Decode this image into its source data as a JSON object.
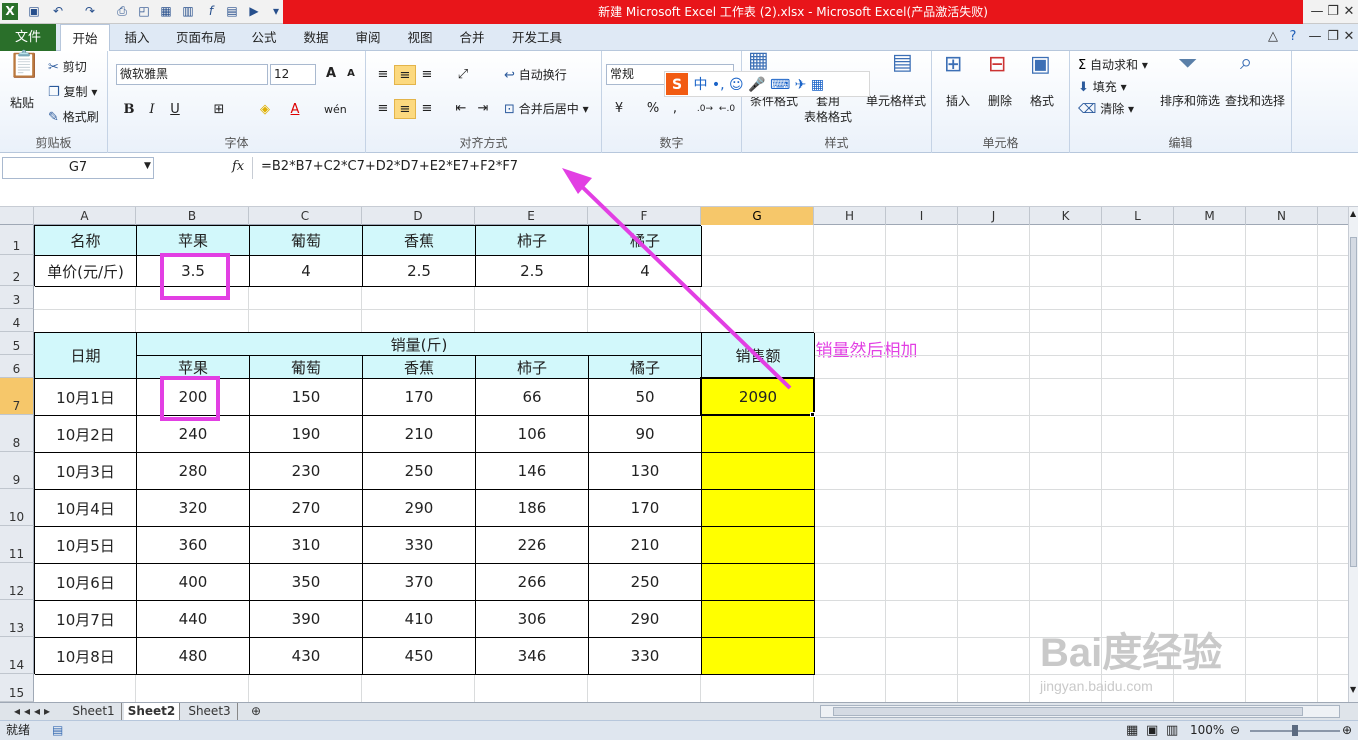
{
  "window": {
    "title": "新建 Microsoft Excel 工作表 (2).xlsx - Microsoft Excel(产品激活失败)"
  },
  "tabs": [
    "文件",
    "开始",
    "插入",
    "页面布局",
    "公式",
    "数据",
    "审阅",
    "视图",
    "合并",
    "开发工具"
  ],
  "ribbon": {
    "clipboard": {
      "paste": "粘贴",
      "cut": "剪切",
      "copy": "复制",
      "painter": "格式刷",
      "label": "剪贴板"
    },
    "font": {
      "name": "微软雅黑",
      "size": "12",
      "label": "字体"
    },
    "align": {
      "wrap": "自动换行",
      "merge": "合并后居中",
      "label": "对齐方式"
    },
    "number": {
      "format": "常规",
      "label": "数字"
    },
    "styles": {
      "cond": "条件格式",
      "table": "套用\n表格格式",
      "cell": "单元格样式",
      "label": "样式"
    },
    "cells": {
      "insert": "插入",
      "delete": "删除",
      "format": "格式",
      "label": "单元格"
    },
    "edit": {
      "autosum": "自动求和",
      "fill": "填充",
      "clear": "清除",
      "sort": "排序和筛选",
      "find": "查找和选择",
      "label": "编辑"
    }
  },
  "formula_bar": {
    "namebox": "G7",
    "fx": "fx",
    "formula": "=B2*B7+C2*C7+D2*D7+E2*E7+F2*F7"
  },
  "annotation": "需要用每一个品种的单价*销量然后相加",
  "columns": [
    "A",
    "B",
    "C",
    "D",
    "E",
    "F",
    "G",
    "H",
    "I",
    "J",
    "K",
    "L",
    "M",
    "N"
  ],
  "rows": [
    "1",
    "2",
    "3",
    "4",
    "5",
    "6",
    "7",
    "8",
    "9",
    "10",
    "11",
    "12",
    "13",
    "14",
    "15"
  ],
  "table1": {
    "header": [
      "名称",
      "苹果",
      "葡萄",
      "香蕉",
      "柿子",
      "橘子"
    ],
    "price": [
      "单价(元/斤)",
      "3.5",
      "4",
      "2.5",
      "2.5",
      "4"
    ]
  },
  "table2": {
    "date_header": "日期",
    "sales_header": "销量(斤)",
    "amount_header": "销售额",
    "fruits": [
      "苹果",
      "葡萄",
      "香蕉",
      "柿子",
      "橘子"
    ],
    "rows": [
      [
        "10月1日",
        "200",
        "150",
        "170",
        "66",
        "50",
        "2090"
      ],
      [
        "10月2日",
        "240",
        "190",
        "210",
        "106",
        "90",
        ""
      ],
      [
        "10月3日",
        "280",
        "230",
        "250",
        "146",
        "130",
        ""
      ],
      [
        "10月4日",
        "320",
        "270",
        "290",
        "186",
        "170",
        ""
      ],
      [
        "10月5日",
        "360",
        "310",
        "330",
        "226",
        "210",
        ""
      ],
      [
        "10月6日",
        "400",
        "350",
        "370",
        "266",
        "250",
        ""
      ],
      [
        "10月7日",
        "440",
        "390",
        "410",
        "306",
        "290",
        ""
      ],
      [
        "10月8日",
        "480",
        "430",
        "450",
        "346",
        "330",
        ""
      ]
    ]
  },
  "sheets": [
    "Sheet1",
    "Sheet2",
    "Sheet3"
  ],
  "status": {
    "mode": "就绪",
    "zoom": "100%"
  },
  "watermark": {
    "brand": "Bai度经验",
    "url": "jingyan.baidu.com"
  }
}
